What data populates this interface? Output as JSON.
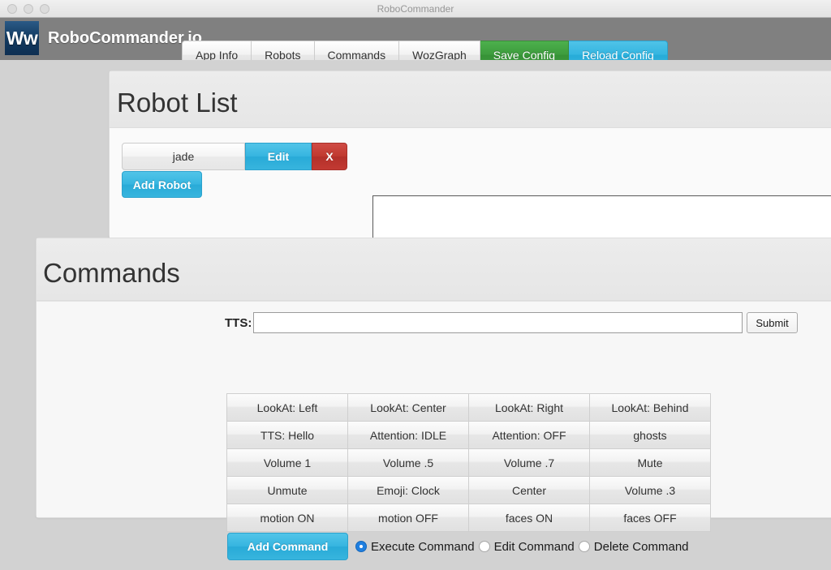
{
  "window": {
    "title": "RoboCommander",
    "traffic_lights": [
      "close-button",
      "minimize-button",
      "zoom-button"
    ]
  },
  "navbar": {
    "logo_text": "Ww",
    "brand": "RoboCommander.io",
    "buttons": [
      {
        "label": "App Info",
        "style": "default"
      },
      {
        "label": "Robots",
        "style": "default"
      },
      {
        "label": "Commands",
        "style": "default"
      },
      {
        "label": "WozGraph",
        "style": "default"
      },
      {
        "label": "Save Config",
        "style": "green"
      },
      {
        "label": "Reload Config",
        "style": "blue"
      }
    ]
  },
  "robot_list": {
    "title": "Robot List",
    "robots": [
      {
        "name": "jade",
        "edit_label": "Edit",
        "delete_label": "X"
      }
    ],
    "add_robot_label": "Add Robot",
    "log_value": "",
    "log_placeholder": ""
  },
  "commands": {
    "title": "Commands",
    "tts": {
      "label": "TTS:",
      "value": "",
      "placeholder": "",
      "submit_label": "Submit"
    },
    "grid": [
      "LookAt: Left",
      "LookAt: Center",
      "LookAt: Right",
      "LookAt: Behind",
      "TTS: Hello",
      "Attention: IDLE",
      "Attention: OFF",
      "ghosts",
      "Volume 1",
      "Volume .5",
      "Volume .7",
      "Mute",
      "Unmute",
      "Emoji: Clock",
      "Center",
      "Volume .3",
      "motion ON",
      "motion OFF",
      "faces ON",
      "faces OFF"
    ],
    "add_command_label": "Add Command",
    "modes": [
      {
        "label": "Execute Command",
        "selected": true
      },
      {
        "label": "Edit Command",
        "selected": false
      },
      {
        "label": "Delete Command",
        "selected": false
      }
    ]
  },
  "colors": {
    "navbar_bg": "#808080",
    "brand_navy": "#123a60",
    "accent_blue": "#36b5e0",
    "accent_green": "#3d9c3d",
    "danger_red": "#c0392f",
    "page_bg": "#d2d2d2",
    "radio_selected": "#1f7fe0"
  }
}
